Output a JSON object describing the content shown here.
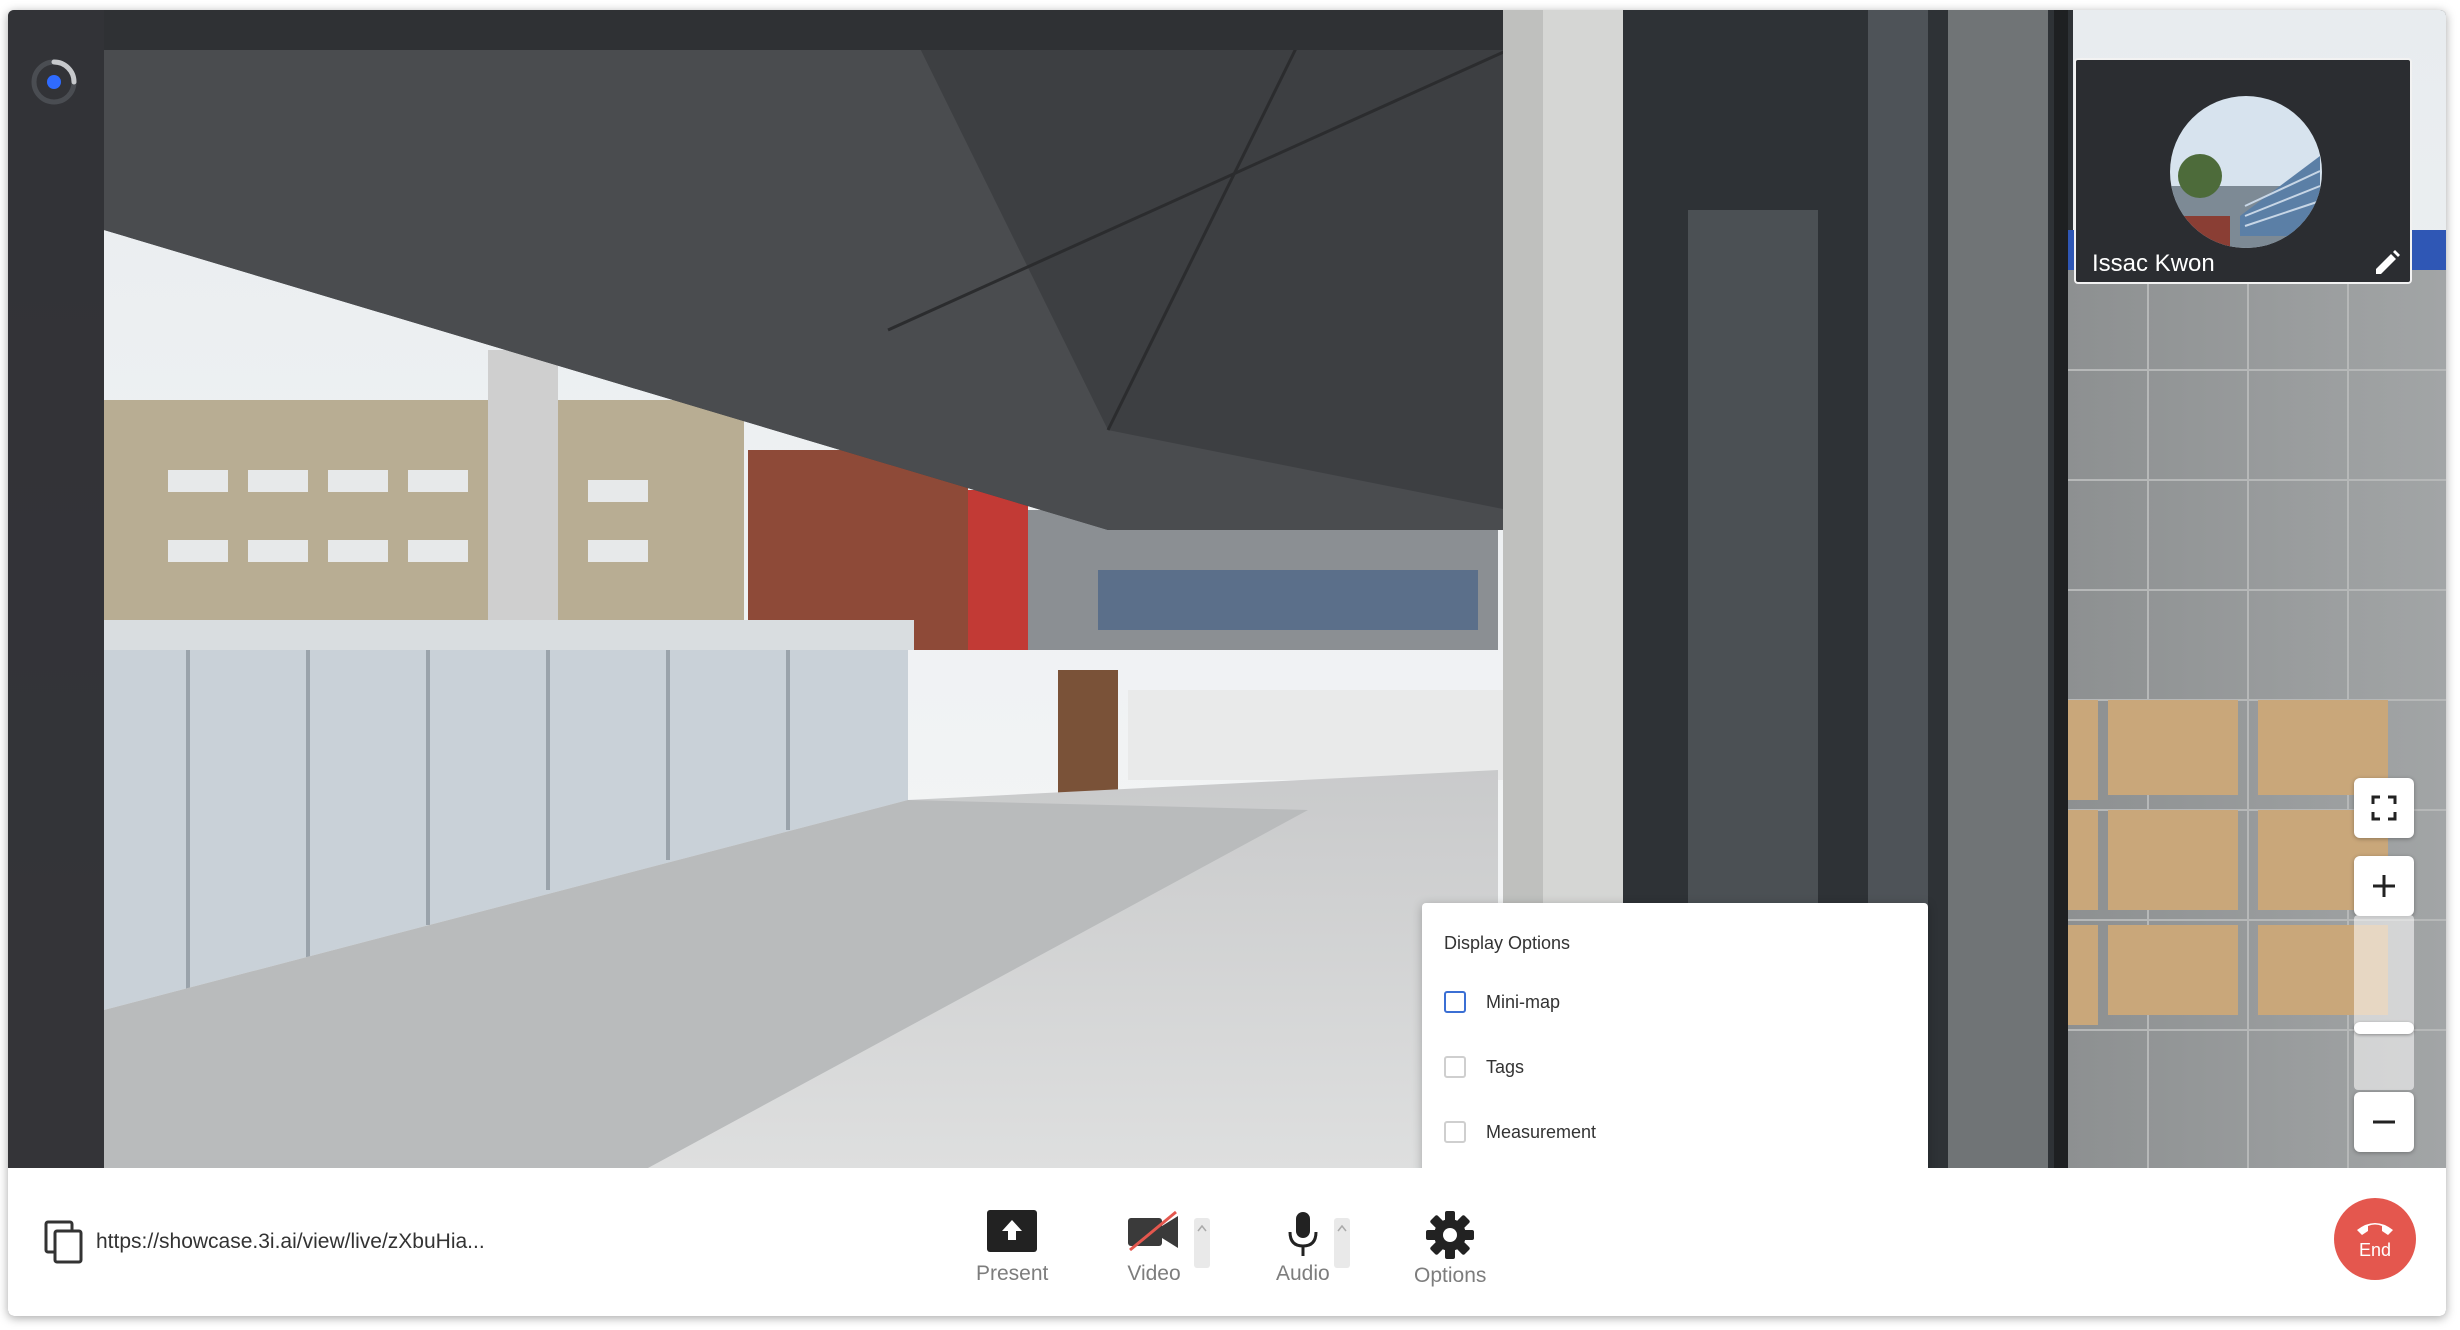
{
  "presenter": {
    "name": "Issac Kwon"
  },
  "options_panel": {
    "title": "Display Options",
    "items": [
      {
        "label": "Mini-map",
        "checked": false
      },
      {
        "label": "Tags",
        "checked": false
      },
      {
        "label": "Measurement",
        "checked": false
      }
    ]
  },
  "share": {
    "url": "https://showcase.3i.ai/view/live/zXbuHia..."
  },
  "controls": {
    "present_label": "Present",
    "video_label": "Video",
    "audio_label": "Audio",
    "options_label": "Options",
    "end_label": "End"
  },
  "colors": {
    "end_button": "#e4574e",
    "accent": "#3b6fd4",
    "loader": "#2f6bff"
  },
  "icons": [
    "loader-icon",
    "edit-icon",
    "fullscreen-icon",
    "zoom-in-icon",
    "zoom-out-icon",
    "copy-icon",
    "present-icon",
    "video-off-icon",
    "mic-icon",
    "gear-icon",
    "phone-hangup-icon"
  ]
}
